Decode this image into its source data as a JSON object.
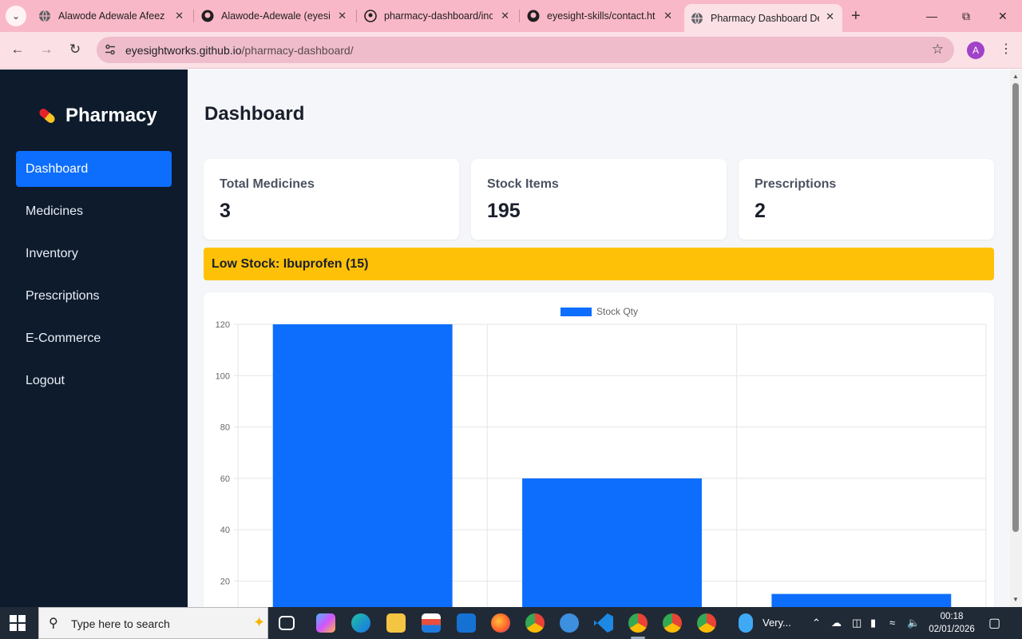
{
  "browser": {
    "tabs": [
      {
        "title": "Alawode Adewale Afeez |",
        "icon": "globe-icon"
      },
      {
        "title": "Alawode-Adewale (eyesig",
        "icon": "github-icon"
      },
      {
        "title": "pharmacy-dashboard/inc",
        "icon": "github-icon"
      },
      {
        "title": "eyesight-skills/contact.ht",
        "icon": "github-icon"
      },
      {
        "title": "Pharmacy Dashboard De",
        "icon": "globe-icon"
      }
    ],
    "url_host": "eyesightworks.github.io",
    "url_path": "/pharmacy-dashboard/",
    "profile_initial": "A"
  },
  "sidebar": {
    "brand": "Pharmacy",
    "items": [
      {
        "label": "Dashboard",
        "active": true
      },
      {
        "label": "Medicines"
      },
      {
        "label": "Inventory"
      },
      {
        "label": "Prescriptions"
      },
      {
        "label": "E-Commerce"
      },
      {
        "label": "Logout"
      }
    ]
  },
  "main": {
    "title": "Dashboard",
    "cards": [
      {
        "label": "Total Medicines",
        "value": "3"
      },
      {
        "label": "Stock Items",
        "value": "195"
      },
      {
        "label": "Prescriptions",
        "value": "2"
      }
    ],
    "alert": "Low Stock: Ibuprofen (15)"
  },
  "chart_data": {
    "type": "bar",
    "series": [
      {
        "name": "Stock Qty",
        "values": [
          120,
          60,
          15
        ],
        "color": "#0d6efd"
      }
    ],
    "ylim": [
      0,
      120
    ],
    "yticks": [
      20,
      40,
      60,
      80,
      100,
      120
    ],
    "grid": true,
    "legend": "top-center"
  },
  "taskbar": {
    "search_placeholder": "Type here to search",
    "weather": "Very...",
    "time": "00:18",
    "date": "02/01/2026"
  },
  "colors": {
    "accent": "#0d6efd",
    "sidebar": "#0e1b2c",
    "warning": "#ffc107",
    "tabbar": "#f9b8c8"
  }
}
